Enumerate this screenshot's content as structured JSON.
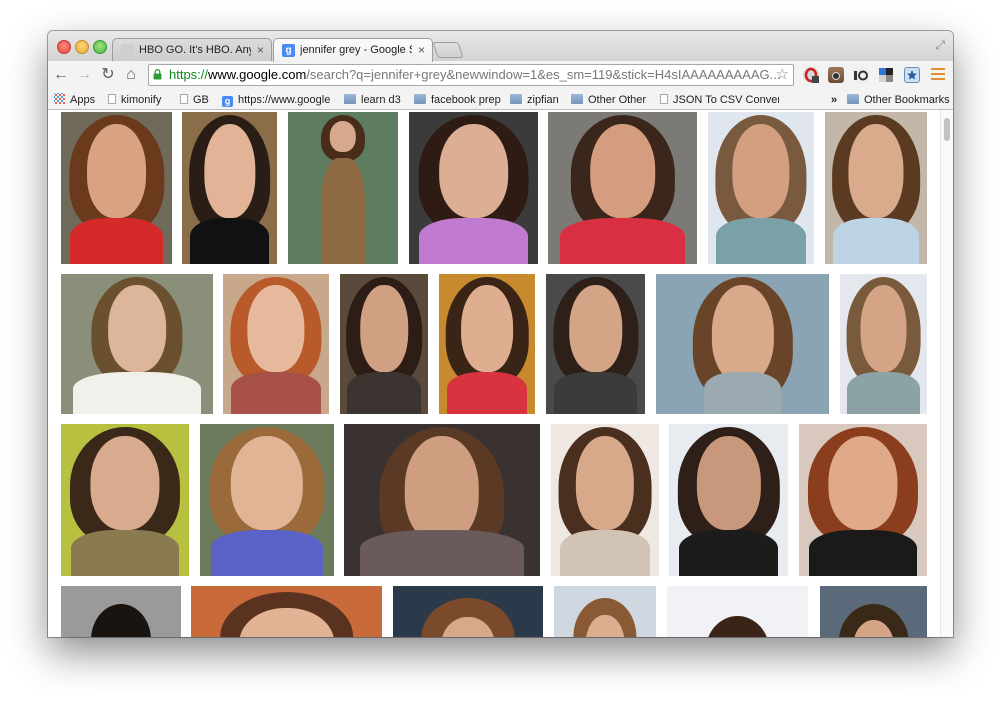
{
  "tabs": [
    {
      "title": "HBO GO. It's HBO. Anywhe",
      "close": "×",
      "favicon": "hbo-favicon",
      "active": false
    },
    {
      "title": "jennifer grey - Google Sea",
      "close": "×",
      "favicon": "google-favicon",
      "active": true
    }
  ],
  "omnibox": {
    "scheme": "https://",
    "host": "www.google.com",
    "rest": "/search?q=jennifer+grey&newwindow=1&es_sm=119&stick=H4sIAAAAAAAAAG..."
  },
  "toolbar": {
    "back": "←",
    "forward": "→",
    "reload": "↻",
    "home": "⌂",
    "star": "☆",
    "expand": "⤢"
  },
  "bookmarks": {
    "items": [
      {
        "label": "Apps",
        "icon": "apps-icon"
      },
      {
        "label": "kimonify",
        "icon": "page-icon"
      },
      {
        "label": "GB",
        "icon": "page-icon"
      },
      {
        "label": "https://www.google...",
        "icon": "google-icon"
      },
      {
        "label": "learn d3",
        "icon": "folder-icon"
      },
      {
        "label": "facebook prep",
        "icon": "folder-icon"
      },
      {
        "label": "zipfian",
        "icon": "folder-icon"
      },
      {
        "label": "Other Other",
        "icon": "folder-icon"
      },
      {
        "label": "JSON To CSV Conver",
        "icon": "page-icon"
      }
    ],
    "chevron": "»",
    "other": "Other Bookmarks"
  },
  "colors": {
    "url_scheme": "#0a8a1e",
    "menu": "#e3912f",
    "folder": "#7495bb"
  }
}
